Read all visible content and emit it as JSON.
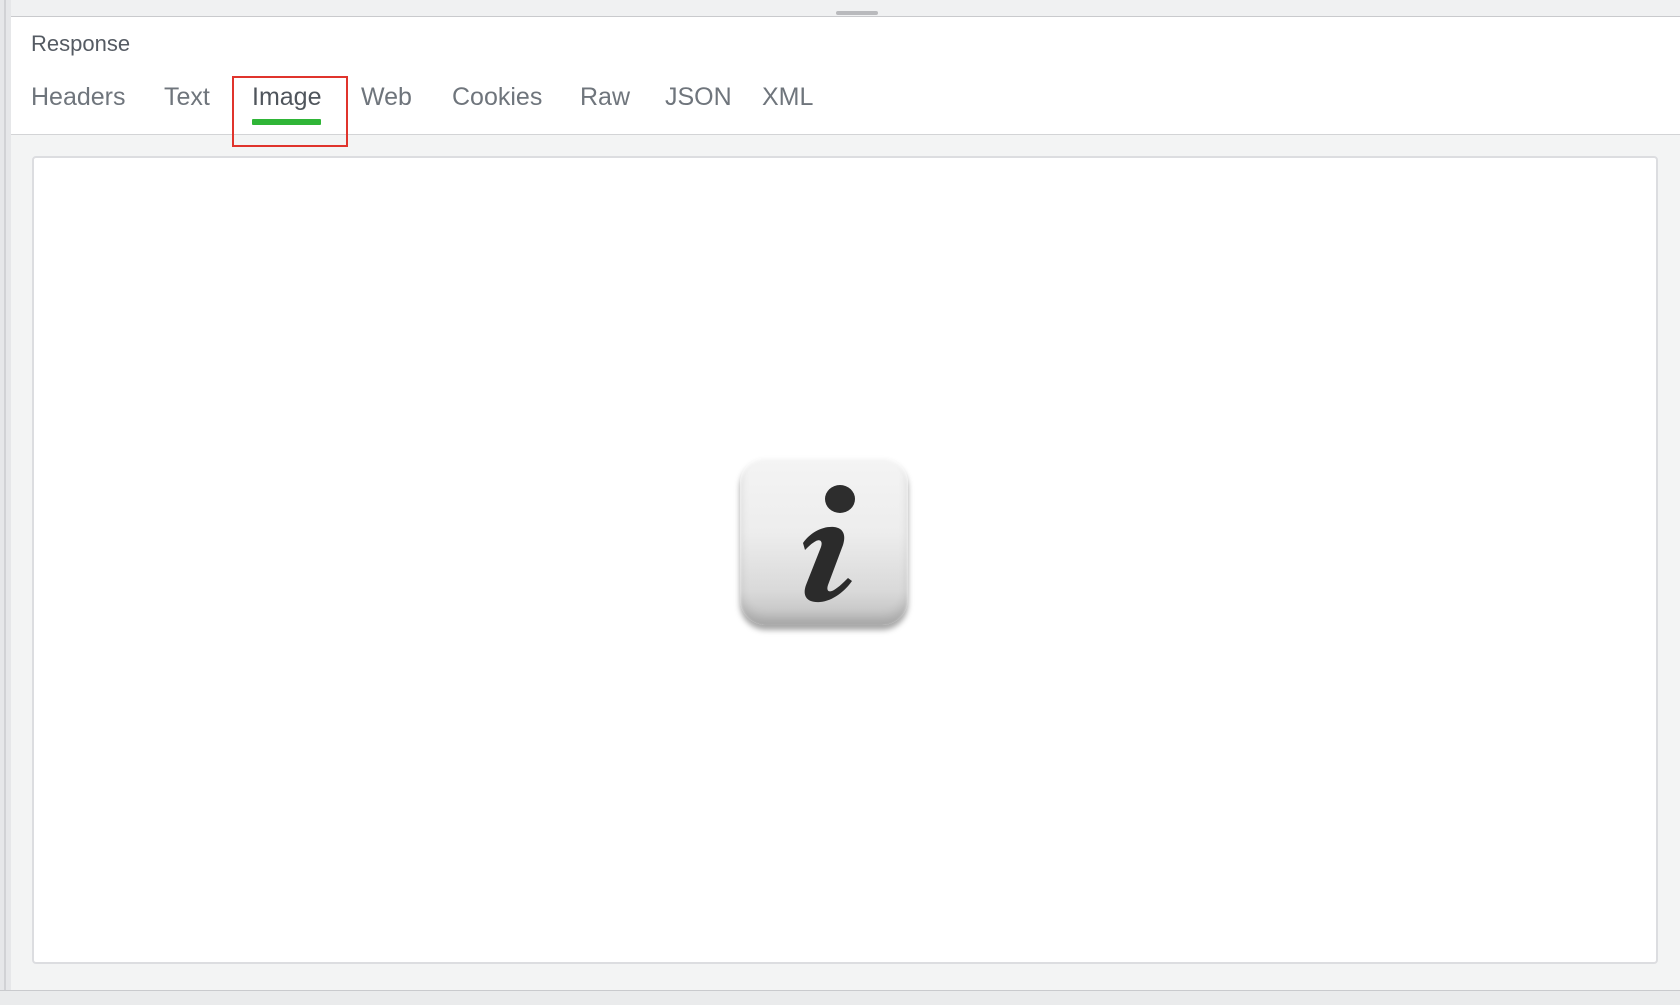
{
  "panel": {
    "title": "Response"
  },
  "tabs": [
    {
      "label": "Headers",
      "active": false
    },
    {
      "label": "Text",
      "active": false
    },
    {
      "label": "Image",
      "active": true
    },
    {
      "label": "Web",
      "active": false
    },
    {
      "label": "Cookies",
      "active": false
    },
    {
      "label": "Raw",
      "active": false
    },
    {
      "label": "JSON",
      "active": false
    },
    {
      "label": "XML",
      "active": false
    }
  ],
  "colors": {
    "active_underline": "#2fb537",
    "highlight_box": "#e0342c"
  },
  "viewer": {
    "image_icon": "info-icon"
  }
}
